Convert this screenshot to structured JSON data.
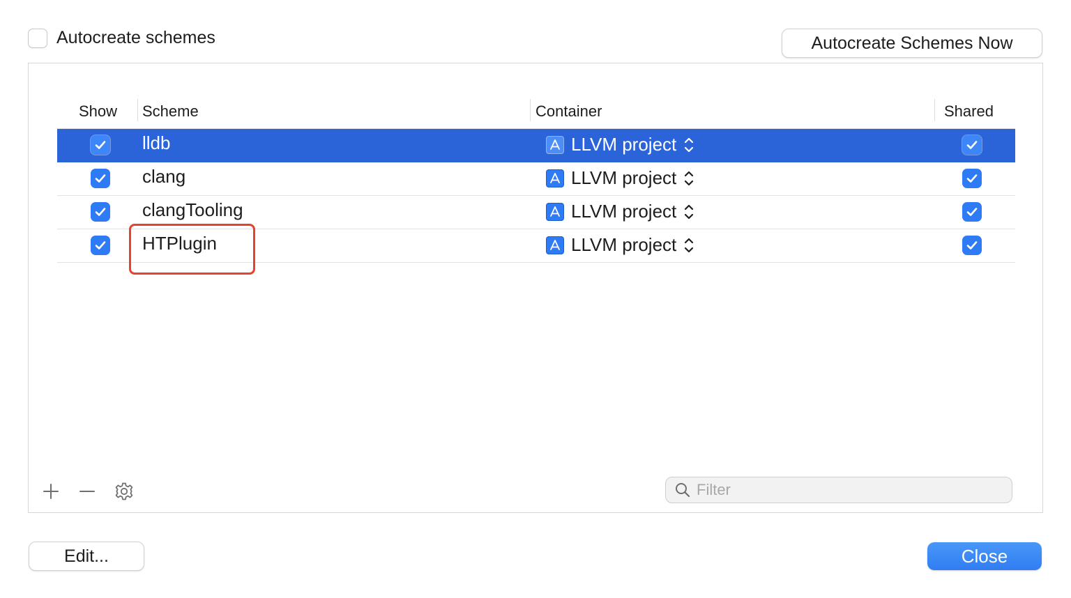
{
  "autocreate": {
    "label": "Autocreate schemes",
    "checked": false
  },
  "buttons": {
    "autocreate_now": "Autocreate Schemes Now",
    "edit": "Edit...",
    "close": "Close"
  },
  "table": {
    "headers": {
      "show": "Show",
      "scheme": "Scheme",
      "container": "Container",
      "shared": "Shared"
    },
    "rows": [
      {
        "show": true,
        "scheme": "lldb",
        "container": "LLVM project",
        "shared": true,
        "selected": true
      },
      {
        "show": true,
        "scheme": "clang",
        "container": "LLVM project",
        "shared": true,
        "selected": false
      },
      {
        "show": true,
        "scheme": "clangTooling",
        "container": "LLVM project",
        "shared": true,
        "selected": false
      },
      {
        "show": true,
        "scheme": "HTPlugin",
        "container": "LLVM project",
        "shared": true,
        "selected": false,
        "annotated": true
      }
    ]
  },
  "toolbar": {
    "icons": [
      "plus-icon",
      "minus-icon",
      "gear-icon"
    ]
  },
  "filter": {
    "placeholder": "Filter",
    "value": ""
  },
  "colors": {
    "accent": "#2f7bf5",
    "selection": "#2b63d9",
    "annotation": "#e5432f"
  }
}
